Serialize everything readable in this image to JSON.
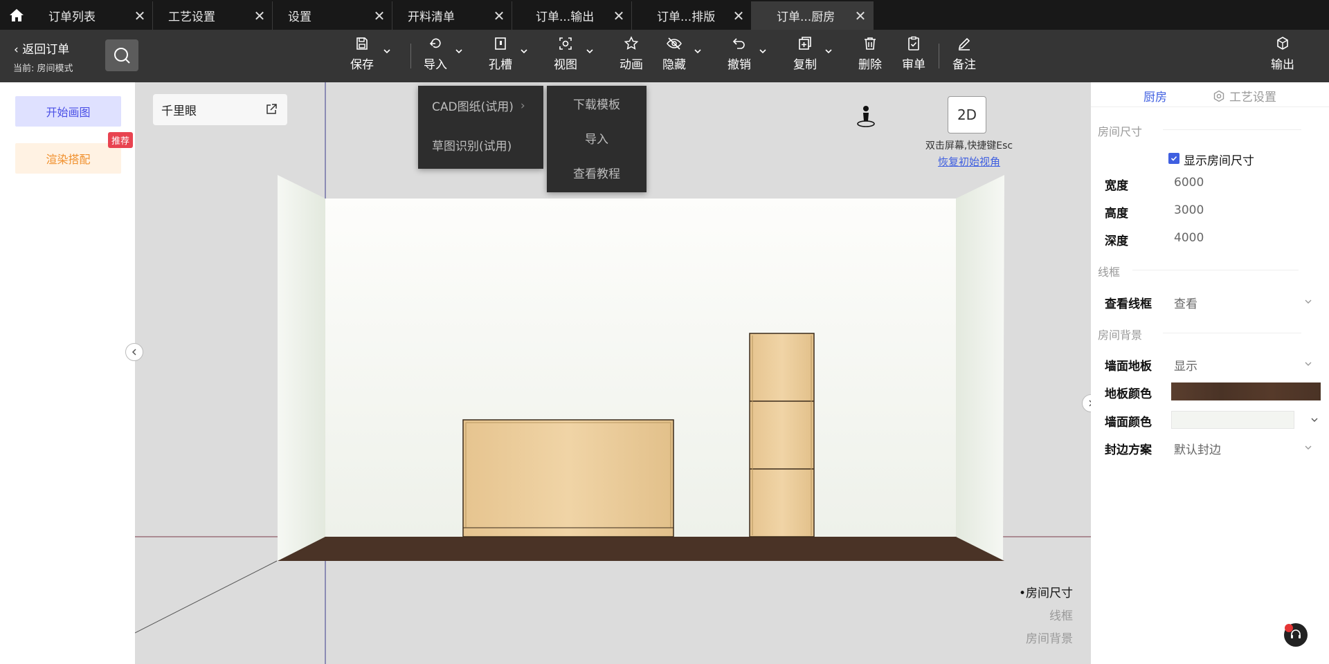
{
  "tabs": [
    {
      "label": "订单列表",
      "active": false
    },
    {
      "label": "工艺设置",
      "active": false
    },
    {
      "label": "设置",
      "active": false
    },
    {
      "label": "开料清单",
      "active": false
    },
    {
      "label": "订单...输出",
      "active": false
    },
    {
      "label": "订单...排版",
      "active": false
    },
    {
      "label": "订单...厨房",
      "active": true
    }
  ],
  "toolbar": {
    "back_label": "返回订单",
    "mode_text": "当前: 房间模式",
    "tools": {
      "save": "保存",
      "import": "导入",
      "slot": "孔槽",
      "view": "视图",
      "animation": "动画",
      "hide": "隐藏",
      "undo": "撤销",
      "copy": "复制",
      "delete": "删除",
      "review": "审单",
      "note": "备注",
      "output": "输出"
    }
  },
  "left_panel": {
    "start_draw": "开始画图",
    "render_match": "渲染搭配",
    "recommend_badge": "推荐"
  },
  "canvas": {
    "qianliyan": "千里眼",
    "import_menu": [
      "CAD图纸(试用)",
      "草图识别(试用)"
    ],
    "sub_menu": [
      "下载模板",
      "导入",
      "查看教程"
    ],
    "view_2d": "2D",
    "hint": "双击屏幕,快捷键Esc",
    "restore_view": "恢复初始视角",
    "legend_nav": [
      "•房间尺寸",
      "线框",
      "房间背景"
    ]
  },
  "right_panel": {
    "tab_kitchen": "厨房",
    "tab_craft": "工艺设置",
    "room_size_title": "房间尺寸",
    "show_room_size": "显示房间尺寸",
    "width_label": "宽度",
    "width_value": "6000",
    "height_label": "高度",
    "height_value": "3000",
    "depth_label": "深度",
    "depth_value": "4000",
    "wireframe_title": "线框",
    "view_wireframe_label": "查看线框",
    "view_wireframe_value": "查看",
    "room_bg_title": "房间背景",
    "wall_floor_label": "墙面地板",
    "wall_floor_value": "显示",
    "floor_color_label": "地板颜色",
    "wall_color_label": "墙面颜色",
    "edge_label": "封边方案",
    "edge_value": "默认封边"
  },
  "colors": {
    "accent": "#3f5fe0",
    "floor": "#4a3326",
    "wall": "#f3f5f1",
    "cabinet": "#e8c896"
  }
}
